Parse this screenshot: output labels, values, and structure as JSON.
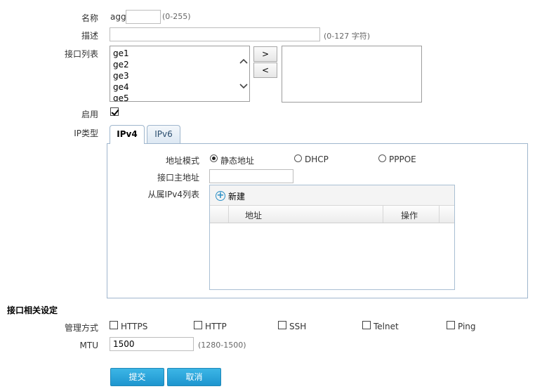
{
  "form": {
    "name": {
      "label": "名称",
      "prefix": "agg",
      "value": "",
      "hint": "(0-255)"
    },
    "description": {
      "label": "描述",
      "value": "",
      "hint": "(0-127 字符)"
    },
    "interface_list": {
      "label": "接口列表",
      "available": [
        "ge1",
        "ge2",
        "ge3",
        "ge4",
        "ge5"
      ],
      "selected": [],
      "move_right_label": ">",
      "move_left_label": "<"
    },
    "enable": {
      "label": "启用",
      "checked": true
    },
    "ip_type": {
      "label": "IP类型",
      "tabs": [
        {
          "label": "IPv4",
          "active": true
        },
        {
          "label": "IPv6",
          "active": false
        }
      ],
      "address_mode": {
        "label": "地址模式",
        "options": [
          {
            "label": "静态地址",
            "selected": true
          },
          {
            "label": "DHCP",
            "selected": false
          },
          {
            "label": "PPPOE",
            "selected": false
          }
        ]
      },
      "primary_address": {
        "label": "接口主地址",
        "value": ""
      },
      "secondary_list": {
        "label": "从属IPv4列表",
        "new_label": "新建",
        "columns": [
          "地址",
          "操作"
        ],
        "rows": []
      }
    }
  },
  "interface_settings": {
    "title": "接口相关设定",
    "management": {
      "label": "管理方式",
      "options": [
        {
          "label": "HTTPS",
          "checked": false
        },
        {
          "label": "HTTP",
          "checked": false
        },
        {
          "label": "SSH",
          "checked": false
        },
        {
          "label": "Telnet",
          "checked": false
        },
        {
          "label": "Ping",
          "checked": false
        }
      ]
    },
    "mtu": {
      "label": "MTU",
      "value": "1500",
      "hint": "(1280-1500)"
    }
  },
  "actions": {
    "submit_label": "提交",
    "cancel_label": "取消"
  },
  "colors": {
    "button": "#1e95cf",
    "tab_border": "#9fb6cd",
    "add_icon": "#2a8fc6"
  }
}
